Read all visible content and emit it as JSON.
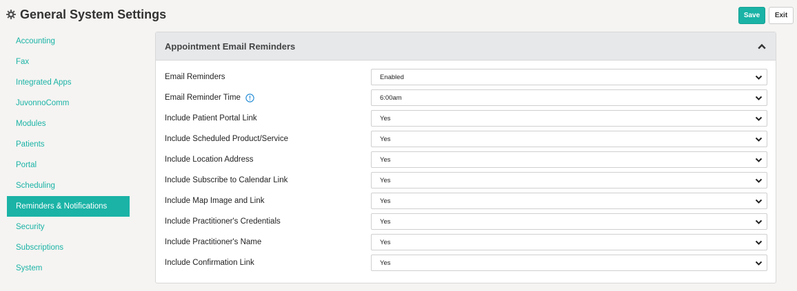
{
  "page": {
    "title": "General System Settings"
  },
  "toolbar": {
    "save_label": "Save",
    "exit_label": "Exit"
  },
  "sidebar": {
    "items": [
      {
        "label": "Accounting",
        "active": false
      },
      {
        "label": "Fax",
        "active": false
      },
      {
        "label": "Integrated Apps",
        "active": false
      },
      {
        "label": "JuvonnoComm",
        "active": false
      },
      {
        "label": "Modules",
        "active": false
      },
      {
        "label": "Patients",
        "active": false
      },
      {
        "label": "Portal",
        "active": false
      },
      {
        "label": "Scheduling",
        "active": false
      },
      {
        "label": "Reminders & Notifications",
        "active": true
      },
      {
        "label": "Security",
        "active": false
      },
      {
        "label": "Subscriptions",
        "active": false
      },
      {
        "label": "System",
        "active": false
      }
    ]
  },
  "panel": {
    "title": "Appointment Email Reminders",
    "settings": [
      {
        "label": "Email Reminders",
        "value": "Enabled",
        "info": false
      },
      {
        "label": "Email Reminder Time",
        "value": "6:00am",
        "info": true
      },
      {
        "label": "Include Patient Portal Link",
        "value": "Yes",
        "info": false
      },
      {
        "label": "Include Scheduled Product/Service",
        "value": "Yes",
        "info": false
      },
      {
        "label": "Include Location Address",
        "value": "Yes",
        "info": false
      },
      {
        "label": "Include Subscribe to Calendar Link",
        "value": "Yes",
        "info": false
      },
      {
        "label": "Include Map Image and Link",
        "value": "Yes",
        "info": false
      },
      {
        "label": "Include Practitioner's Credentials",
        "value": "Yes",
        "info": false
      },
      {
        "label": "Include Practitioner's Name",
        "value": "Yes",
        "info": false
      },
      {
        "label": "Include Confirmation Link",
        "value": "Yes",
        "info": false
      }
    ]
  },
  "colors": {
    "accent": "#1ab3a6",
    "panel_header": "#e6e8ea",
    "info": "#2a8fd6"
  },
  "icons": {
    "title": "gear-icon",
    "collapse": "chevron-up-icon",
    "select": "chevron-down-icon",
    "info": "info-circle-icon"
  }
}
